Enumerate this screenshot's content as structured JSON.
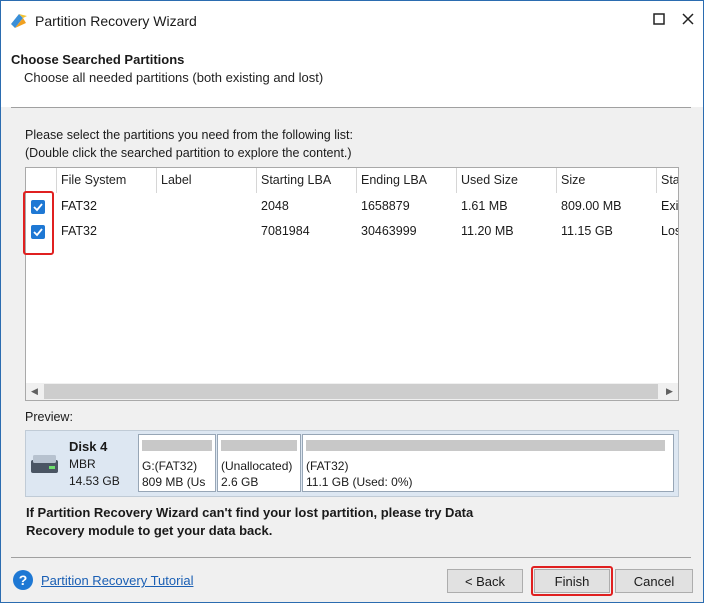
{
  "window": {
    "title": "Partition Recovery Wizard"
  },
  "header": {
    "title": "Choose Searched Partitions",
    "subtitle": "Choose all needed partitions (both existing and lost)"
  },
  "instructions": {
    "line1": "Please select the partitions you need from the following list:",
    "line2": "(Double click the searched partition to explore the content.)"
  },
  "table": {
    "columns": [
      "File System",
      "Label",
      "Starting LBA",
      "Ending LBA",
      "Used Size",
      "Size",
      "Sta"
    ],
    "rows": [
      {
        "checked": true,
        "cells": [
          "FAT32",
          "",
          "2048",
          "1658879",
          "1.61 MB",
          "809.00 MB",
          "Exi"
        ]
      },
      {
        "checked": true,
        "cells": [
          "FAT32",
          "",
          "7081984",
          "30463999",
          "11.20 MB",
          "11.15 GB",
          "Los"
        ]
      }
    ]
  },
  "preview": {
    "label": "Preview:",
    "disk": {
      "name": "Disk 4",
      "type": "MBR",
      "size": "14.53 GB"
    },
    "partitions": [
      {
        "name": "G:(FAT32)",
        "detail": "809 MB (Us"
      },
      {
        "name": "(Unallocated)",
        "detail": "2.6 GB"
      },
      {
        "name": "(FAT32)",
        "detail": "11.1 GB (Used: 0%)"
      }
    ]
  },
  "message": "If Partition Recovery Wizard can't find your lost partition, please try Data Recovery module to get your data back.",
  "footer": {
    "tutorial_link": "Partition Recovery Tutorial",
    "back_label": "< Back",
    "finish_label": "Finish",
    "cancel_label": "Cancel"
  },
  "colors": {
    "accent": "#1e78d4",
    "highlight": "#e02020",
    "link": "#1a5fb4"
  }
}
